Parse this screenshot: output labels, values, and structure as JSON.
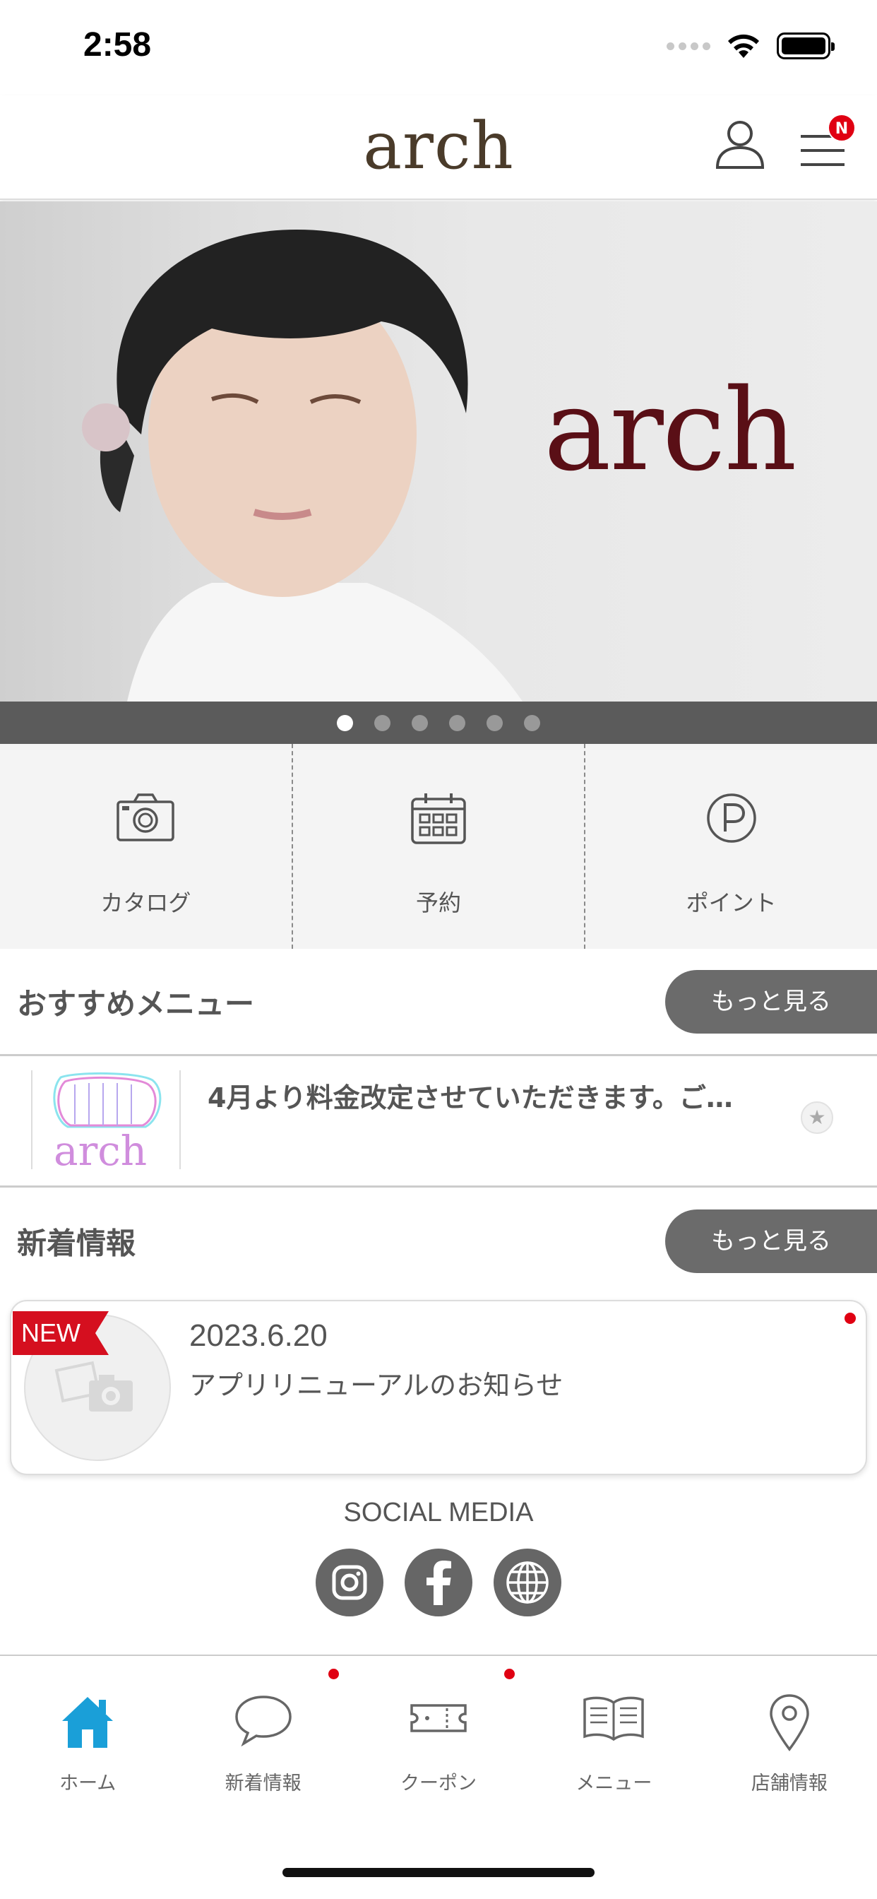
{
  "status_bar": {
    "time": "2:58"
  },
  "header": {
    "logo": "arch",
    "menu_badge": "N"
  },
  "hero": {
    "brand_text": "arch",
    "slide_count": 6,
    "active_slide": 1
  },
  "quick_actions": [
    {
      "label": "カタログ",
      "icon": "camera-icon"
    },
    {
      "label": "予約",
      "icon": "calendar-icon"
    },
    {
      "label": "ポイント",
      "icon": "point-icon"
    }
  ],
  "recommended": {
    "title": "おすすめメニュー",
    "more_label": "もっと見る",
    "items": [
      {
        "text": "4月より料金改定させていただきます。ご…",
        "thumb_text": "arch"
      }
    ]
  },
  "news": {
    "title": "新着情報",
    "more_label": "もっと見る",
    "items": [
      {
        "badge": "NEW",
        "date": "2023.6.20",
        "title": "アプリリニューアルのお知らせ",
        "unread": true
      }
    ]
  },
  "social": {
    "title": "SOCIAL MEDIA",
    "icons": [
      "instagram-icon",
      "facebook-icon",
      "globe-icon"
    ]
  },
  "tab_bar": {
    "active": "home",
    "accent": "#1a9fd8",
    "tabs": [
      {
        "label": "ホーム",
        "icon": "home-icon",
        "dot": false
      },
      {
        "label": "新着情報",
        "icon": "chat-icon",
        "dot": true
      },
      {
        "label": "クーポン",
        "icon": "ticket-icon",
        "dot": true
      },
      {
        "label": "メニュー",
        "icon": "book-icon",
        "dot": false
      },
      {
        "label": "店舗情報",
        "icon": "location-pin-icon",
        "dot": false
      }
    ]
  },
  "colors": {
    "badge_red": "#e00012",
    "button_gray": "#6b6b6b",
    "brand_maroon": "#5a0f16"
  }
}
